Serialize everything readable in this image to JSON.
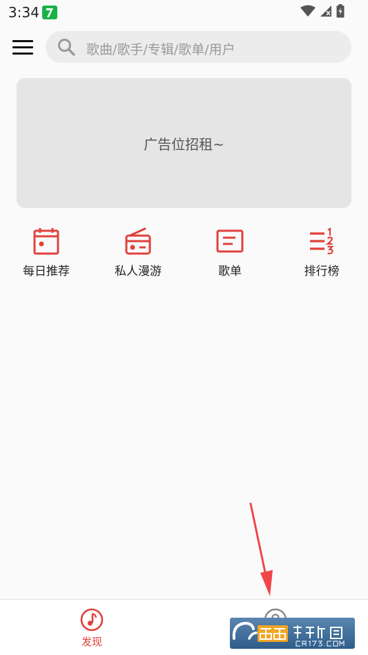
{
  "status_bar": {
    "time": "3:34",
    "app_badge_glyph": "7",
    "icons": [
      "wifi-icon",
      "signal-no-sim-icon",
      "battery-charging-icon"
    ]
  },
  "header": {
    "menu_icon": "hamburger-menu-icon",
    "search": {
      "icon": "search-icon",
      "placeholder": "歌曲/歌手/专辑/歌单/用户"
    }
  },
  "banner": {
    "text": "广告位招租~"
  },
  "quick_entries": [
    {
      "label": "每日推荐",
      "icon": "calendar-icon"
    },
    {
      "label": "私人漫游",
      "icon": "radio-icon"
    },
    {
      "label": "歌单",
      "icon": "playlist-icon"
    },
    {
      "label": "排行榜",
      "icon": "ranking-icon"
    }
  ],
  "bottom_nav": {
    "tabs": [
      {
        "label": "发现",
        "icon": "music-note-icon",
        "active": true
      },
      {
        "label": "",
        "icon": "user-profile-icon",
        "active": false
      }
    ]
  },
  "watermark": {
    "text": "西西软件园",
    "subtext": "CR173.COM"
  },
  "colors": {
    "accent": "#e0413b",
    "background": "#fafafa",
    "search_bg": "#ececec",
    "banner_bg": "#e5e5e5",
    "annotation_arrow": "#f0464a"
  }
}
